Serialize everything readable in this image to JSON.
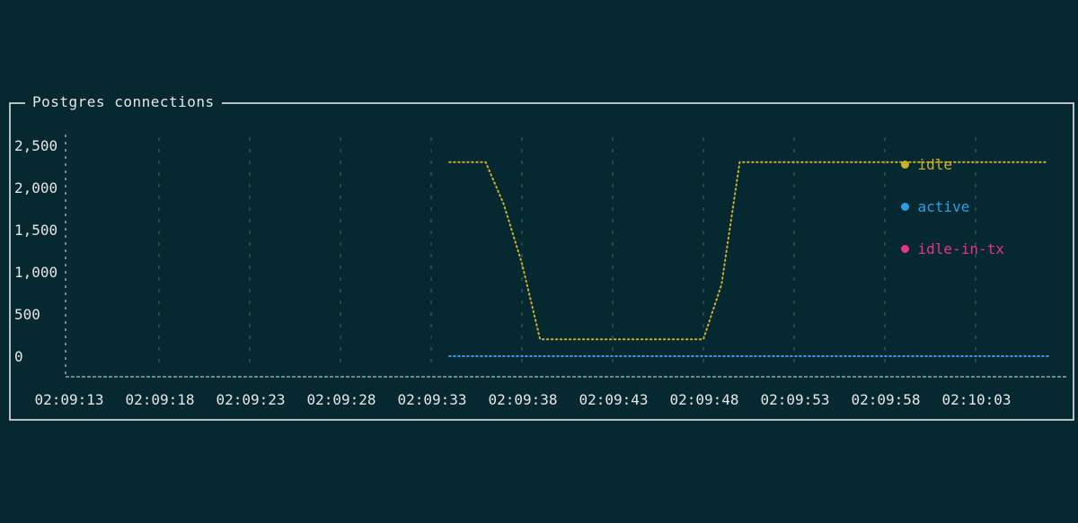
{
  "chart_data": {
    "type": "line",
    "title": "Postgres connections",
    "x": [
      "02:09:13",
      "02:09:14",
      "02:09:15",
      "02:09:16",
      "02:09:17",
      "02:09:18",
      "02:09:19",
      "02:09:20",
      "02:09:21",
      "02:09:22",
      "02:09:23",
      "02:09:24",
      "02:09:25",
      "02:09:26",
      "02:09:27",
      "02:09:28",
      "02:09:29",
      "02:09:30",
      "02:09:31",
      "02:09:32",
      "02:09:33",
      "02:09:34",
      "02:09:35",
      "02:09:36",
      "02:09:37",
      "02:09:38",
      "02:09:39",
      "02:09:40",
      "02:09:41",
      "02:09:42",
      "02:09:43",
      "02:09:44",
      "02:09:45",
      "02:09:46",
      "02:09:47",
      "02:09:48",
      "02:09:49",
      "02:09:50",
      "02:09:51",
      "02:09:52",
      "02:09:53",
      "02:09:54",
      "02:09:55",
      "02:09:56",
      "02:09:57",
      "02:09:58",
      "02:09:59",
      "02:10:00",
      "02:10:01",
      "02:10:02",
      "02:10:03",
      "02:10:04",
      "02:10:05",
      "02:10:06",
      "02:10:07"
    ],
    "x_ticks": [
      "02:09:13",
      "02:09:18",
      "02:09:23",
      "02:09:28",
      "02:09:33",
      "02:09:38",
      "02:09:43",
      "02:09:48",
      "02:09:53",
      "02:09:58",
      "02:10:03"
    ],
    "y_ticks": [
      "2,500",
      "2,000",
      "1,500",
      "1,000",
      "500",
      "0"
    ],
    "ylim": [
      0,
      2500
    ],
    "grid": true,
    "legend_position": "top-right",
    "series": [
      {
        "name": "idle",
        "color": "#c9b02c",
        "values": [
          null,
          null,
          null,
          null,
          null,
          null,
          null,
          null,
          null,
          null,
          null,
          null,
          null,
          null,
          null,
          null,
          null,
          null,
          null,
          null,
          null,
          2300,
          2300,
          2300,
          1800,
          1100,
          200,
          200,
          200,
          200,
          200,
          200,
          200,
          200,
          200,
          200,
          850,
          2300,
          2300,
          2300,
          2300,
          2300,
          2300,
          2300,
          2300,
          2300,
          2300,
          2300,
          2300,
          2300,
          2300,
          2300,
          2300,
          2300,
          2300
        ]
      },
      {
        "name": "active",
        "color": "#2b9fe6",
        "values": [
          null,
          null,
          null,
          null,
          null,
          null,
          null,
          null,
          null,
          null,
          null,
          null,
          null,
          null,
          null,
          null,
          null,
          null,
          null,
          null,
          null,
          0,
          0,
          0,
          0,
          0,
          0,
          0,
          0,
          0,
          0,
          0,
          0,
          0,
          0,
          0,
          0,
          0,
          0,
          0,
          0,
          0,
          0,
          0,
          0,
          0,
          0,
          0,
          0,
          0,
          0,
          0,
          0,
          0,
          0
        ]
      },
      {
        "name": "idle-in-tx",
        "color": "#e8328a",
        "values": [
          null,
          null,
          null,
          null,
          null,
          null,
          null,
          null,
          null,
          null,
          null,
          null,
          null,
          null,
          null,
          null,
          null,
          null,
          null,
          null,
          null,
          0,
          0,
          0,
          0,
          0,
          0,
          0,
          0,
          0,
          0,
          0,
          0,
          0,
          0,
          0,
          0,
          0,
          0,
          0,
          0,
          0,
          0,
          0,
          0,
          0,
          0,
          0,
          0,
          0,
          0,
          0,
          0,
          0,
          0
        ]
      }
    ]
  },
  "colors": {
    "background": "#062830",
    "frame": "#e6e6e6",
    "grid": "#3f6b5a",
    "text": "#e6e6e6"
  }
}
